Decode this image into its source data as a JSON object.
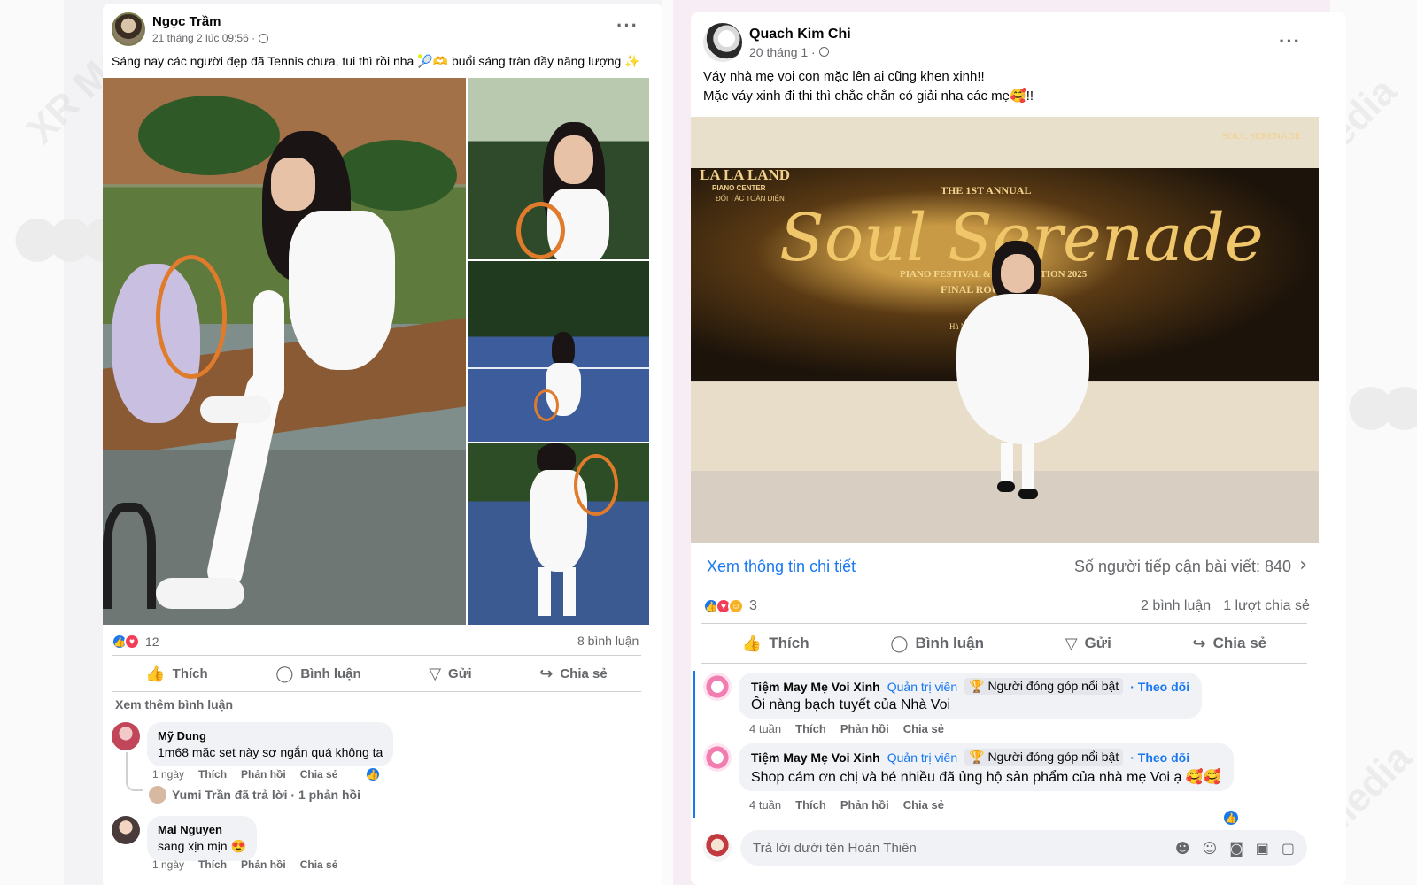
{
  "left_post": {
    "author": "Ngọc Trầm",
    "timestamp": "21 tháng 2 lúc 09:56 ·",
    "privacy_icon": "globe-icon",
    "text": "Sáng nay các người đẹp đã Tennis chưa, tui thì rồi nha 🎾🫶 buổi sáng tràn đầy năng lượng ✨",
    "reaction_count": "12",
    "comments_count": "8 bình luận",
    "actions": {
      "like": "Thích",
      "comment": "Bình luận",
      "send": "Gửi",
      "share": "Chia sẻ"
    },
    "more_comments": "Xem thêm bình luận",
    "comments": [
      {
        "name": "Mỹ Dung",
        "text": "1m68 mặc set này sợ ngắn quá không ta",
        "time": "1 ngày",
        "like": "Thích",
        "reply": "Phản hồi",
        "share": "Chia sẻ"
      },
      {
        "name": "Mai Nguyen",
        "text": "sang xịn mịn 😍",
        "time": "1 ngày",
        "like": "Thích",
        "reply": "Phản hồi",
        "share": "Chia sẻ"
      }
    ],
    "reply_summary": "Yumi Trần đã trả lời · 1 phản hồi"
  },
  "right_post": {
    "author": "Quach Kim Chi",
    "timestamp": "20 tháng 1 ·",
    "privacy_icon": "globe-icon",
    "text_line1": "Váy nhà mẹ voi con mặc lên ai cũng khen xinh!!",
    "text_line2": "Mặc váy xinh đi thi thì chắc chắn có giải nha các mẹ🥰!!",
    "banner": {
      "brand": "LA LA LAND",
      "brand_sub": "PIANO CENTER",
      "partner": "ĐỐI TÁC TOÀN DIỆN",
      "annual": "THE 1ST ANNUAL",
      "title": "Soul Serenade",
      "festival": "PIANO FESTIVAL & COMPETITION 2025",
      "round": "FINAL ROUND",
      "city": "Hà Nội",
      "corner": "SOUL SERENADE"
    },
    "details_link": "Xem thông tin chi tiết",
    "reach": "Số người tiếp cận bài viết: 840",
    "reaction_count": "3",
    "comments_count": "2 bình luận",
    "shares_count": "1 lượt chia sẻ",
    "actions": {
      "like": "Thích",
      "comment": "Bình luận",
      "send": "Gửi",
      "share": "Chia sẻ"
    },
    "comments": [
      {
        "name": "Tiệm May Mẹ Voi Xinh",
        "role": "Quản trị viên",
        "badge": "🏆 Người đóng góp nổi bật",
        "follow": "· Theo dõi",
        "text": "Ôi nàng bạch tuyết của Nhà Voi",
        "time": "4 tuần",
        "like": "Thích",
        "reply": "Phản hồi",
        "share": "Chia sẻ"
      },
      {
        "name": "Tiệm May Mẹ Voi Xinh",
        "role": "Quản trị viên",
        "badge": "🏆 Người đóng góp nổi bật",
        "follow": "· Theo dõi",
        "text": "Shop cám ơn chị và bé nhiều đã ủng hộ sản phẩm của nhà mẹ Voi ạ 🥰🥰",
        "time": "4 tuần",
        "like": "Thích",
        "reply": "Phản hồi",
        "share": "Chia sẻ"
      }
    ],
    "reply_placeholder": "Trả lời dưới tên Hoàn Thiên"
  },
  "watermark": "XR Media",
  "colors": {
    "facebook_blue": "#1877f2",
    "love_red": "#f33e58",
    "gray_text": "#65676b"
  }
}
